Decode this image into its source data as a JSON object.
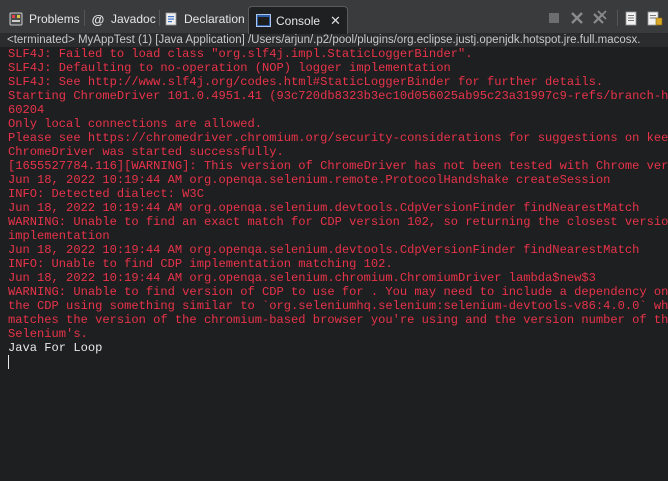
{
  "tabs": [
    {
      "label": "Problems",
      "icon": "problems-icon",
      "active": false
    },
    {
      "label": "Javadoc",
      "icon": "javadoc-icon",
      "active": false
    },
    {
      "label": "Declaration",
      "icon": "declaration-icon",
      "active": false
    },
    {
      "label": "Console",
      "icon": "console-icon",
      "active": true
    }
  ],
  "toolbar": {
    "icons": [
      "terminate-icon",
      "remove-launch-icon",
      "remove-all-terminated-icon",
      "clear-console-icon",
      "scroll-lock-icon"
    ]
  },
  "status_line": "<terminated> MyAppTest (1) [Java Application] /Users/arjun/.p2/pool/plugins/org.eclipse.justj.openjdk.hotspot.jre.full.macosx.",
  "colors": {
    "error_text": "#e8334a",
    "output_text": "#e8e8e8",
    "background": "#1e1f20",
    "tab_bar": "#3a3b3c"
  },
  "console_lines": [
    {
      "text": "SLF4J: Failed to load class \"org.slf4j.impl.StaticLoggerBinder\".",
      "kind": "err"
    },
    {
      "text": "SLF4J: Defaulting to no-operation (NOP) logger implementation",
      "kind": "err"
    },
    {
      "text": "SLF4J: See http://www.slf4j.org/codes.html#StaticLoggerBinder for further details.",
      "kind": "err"
    },
    {
      "text": "Starting ChromeDriver 101.0.4951.41 (93c720db8323b3ec10d056025ab95c23a31997c9-refs/branch-he",
      "kind": "err"
    },
    {
      "text": "60204",
      "kind": "err"
    },
    {
      "text": "Only local connections are allowed.",
      "kind": "err"
    },
    {
      "text": "Please see https://chromedriver.chromium.org/security-considerations for suggestions on keep",
      "kind": "err"
    },
    {
      "text": "ChromeDriver was started successfully.",
      "kind": "err"
    },
    {
      "text": "[1655527784.116][WARNING]: This version of ChromeDriver has not been tested with Chrome vers",
      "kind": "err"
    },
    {
      "text": "Jun 18, 2022 10:19:44 AM org.openqa.selenium.remote.ProtocolHandshake createSession",
      "kind": "err"
    },
    {
      "text": "INFO: Detected dialect: W3C",
      "kind": "err"
    },
    {
      "text": "Jun 18, 2022 10:19:44 AM org.openqa.selenium.devtools.CdpVersionFinder findNearestMatch",
      "kind": "err"
    },
    {
      "text": "WARNING: Unable to find an exact match for CDP version 102, so returning the closest version",
      "kind": "err"
    },
    {
      "text": "implementation",
      "kind": "err"
    },
    {
      "text": "Jun 18, 2022 10:19:44 AM org.openqa.selenium.devtools.CdpVersionFinder findNearestMatch",
      "kind": "err"
    },
    {
      "text": "INFO: Unable to find CDP implementation matching 102.",
      "kind": "err"
    },
    {
      "text": "Jun 18, 2022 10:19:44 AM org.openqa.selenium.chromium.ChromiumDriver lambda$new$3",
      "kind": "err"
    },
    {
      "text": "WARNING: Unable to find version of CDP to use for . You may need to include a dependency on",
      "kind": "err"
    },
    {
      "text": "the CDP using something similar to `org.seleniumhq.selenium:selenium-devtools-v86:4.0.0` whe",
      "kind": "err"
    },
    {
      "text": "matches the version of the chromium-based browser you're using and the version number of the",
      "kind": "err"
    },
    {
      "text": "Selenium's.",
      "kind": "err"
    },
    {
      "text": "Java For Loop",
      "kind": "out"
    }
  ]
}
